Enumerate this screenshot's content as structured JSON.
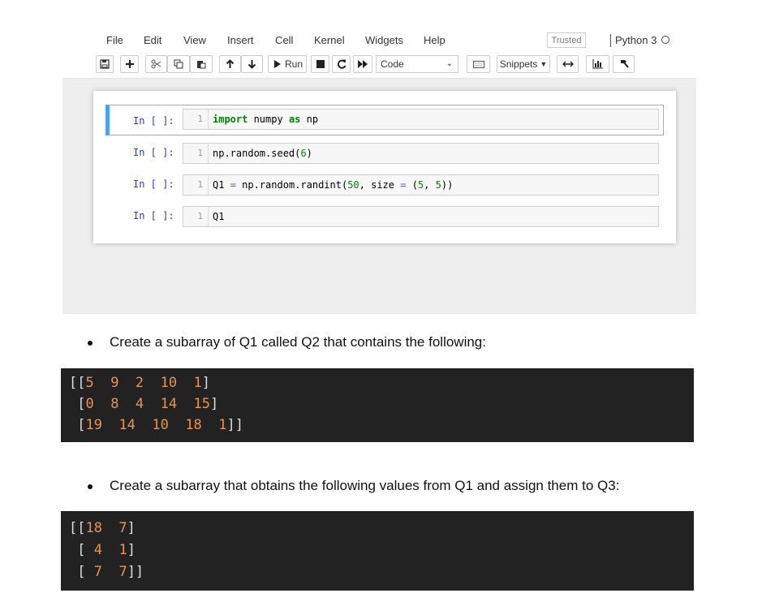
{
  "menu": [
    "File",
    "Edit",
    "View",
    "Insert",
    "Cell",
    "Kernel",
    "Widgets",
    "Help"
  ],
  "status": {
    "trusted": "Trusted",
    "kernel": "Python 3"
  },
  "toolbar": {
    "run_label": "Run",
    "cell_type": "Code",
    "snippets_label": "Snippets",
    "icons": [
      "save-icon",
      "add-cell-icon",
      "cut-icon",
      "copy-icon",
      "paste-icon",
      "move-up-icon",
      "move-down-icon",
      "run-icon",
      "stop-icon",
      "restart-icon",
      "fast-forward-icon",
      "keyboard-icon",
      "snippets-icon",
      "expand-icon",
      "chart-icon",
      "hammer-icon"
    ]
  },
  "cells": [
    {
      "prompt": "In [ ]:",
      "line_number": "1",
      "code": "import numpy as np",
      "selected": true
    },
    {
      "prompt": "In [ ]:",
      "line_number": "1",
      "code": "np.random.seed(6)"
    },
    {
      "prompt": "In [ ]:",
      "line_number": "1",
      "code": "Q1 = np.random.randint(50, size = (5, 5))"
    },
    {
      "prompt": "In [ ]:",
      "line_number": "1",
      "code": "Q1"
    }
  ],
  "task1": {
    "text": "Create a subarray of Q1 called Q2 that contains the following:",
    "lines": [
      "[[5  9  2  10  1]",
      " [0  8  4  14  15]",
      " [19  14  10  18  1]]"
    ]
  },
  "task2": {
    "text": "Create a subarray that obtains the following values from Q1 and assign them to Q3:",
    "lines": [
      "[[18  7]",
      " [ 4  1]",
      " [ 7  7]]"
    ]
  },
  "colors": {
    "accent": "#42a5f5",
    "dark_block": "#222222",
    "number": "#e8934a",
    "keyword": "#008000"
  }
}
